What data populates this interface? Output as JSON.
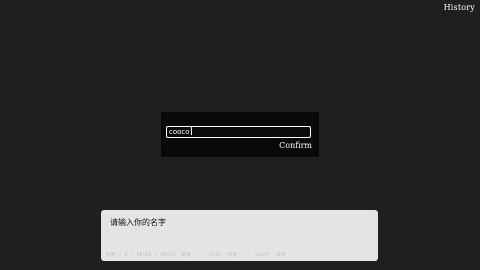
{
  "header": {
    "history_label": "History"
  },
  "name_dialog": {
    "input_value": "cooco",
    "confirm_label": "Confirm"
  },
  "message_box": {
    "prompt": "请输入你的名字",
    "controls_hint": "左键 / Z / ENTER / SPACE  继续      CTRL  快进      SHIFT  菜单"
  },
  "colors": {
    "background": "#1f1f1f",
    "dialog_background": "#090909",
    "message_background": "#e4e4e4",
    "text_light": "#ffffff",
    "text_dark": "#111111"
  }
}
